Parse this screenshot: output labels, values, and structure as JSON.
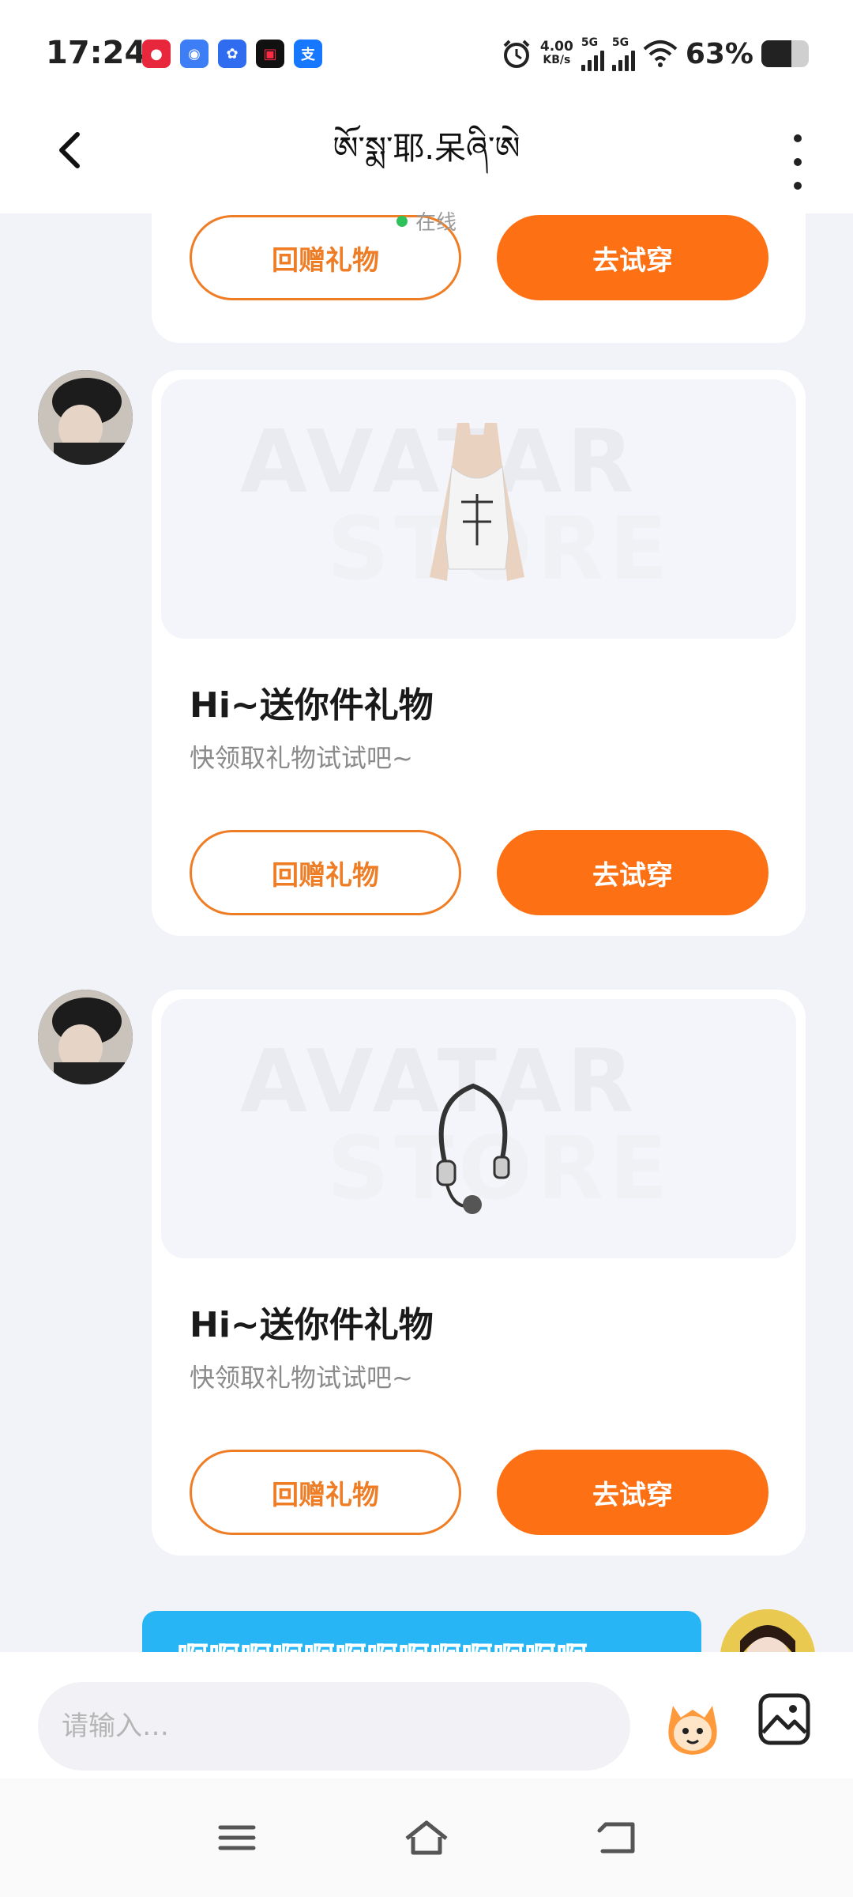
{
  "status_bar": {
    "time": "17:24",
    "net_speed_value": "4.00",
    "net_speed_unit": "KB/s",
    "signal1_label": "5G",
    "signal2_label": "5G",
    "battery_percent": "63%",
    "battery_level": 0.63,
    "app_icons": [
      "taobao-icon",
      "browser-icon",
      "baidu-icon",
      "camera-app-icon",
      "alipay-icon"
    ],
    "alipay_char": "支"
  },
  "header": {
    "title": "ཨོ་སྨ་耶.呆ཞི་ཨེ",
    "status": "在线"
  },
  "messages": {
    "gift_top": {
      "return_label": "回赠礼物",
      "try_label": "去试穿"
    },
    "gift_1": {
      "title": "Hi~送你件礼物",
      "subtitle": "快领取礼物试试吧~",
      "return_label": "回赠礼物",
      "try_label": "去试穿",
      "item": "tank-top-item"
    },
    "gift_2": {
      "title": "Hi~送你件礼物",
      "subtitle": "快领取礼物试试吧~",
      "return_label": "回赠礼物",
      "try_label": "去试穿",
      "item": "headset-item"
    },
    "watermark_line1": "AVATAR",
    "watermark_line2": "STORE",
    "outgoing_text": "啊啊啊啊啊啊啊啊啊啊啊啊啊"
  },
  "input": {
    "placeholder": "请输入…"
  },
  "colors": {
    "accent": "#fd7013",
    "outline": "#ee7d26",
    "bubble": "#27b5f5",
    "online": "#2fc25b"
  }
}
